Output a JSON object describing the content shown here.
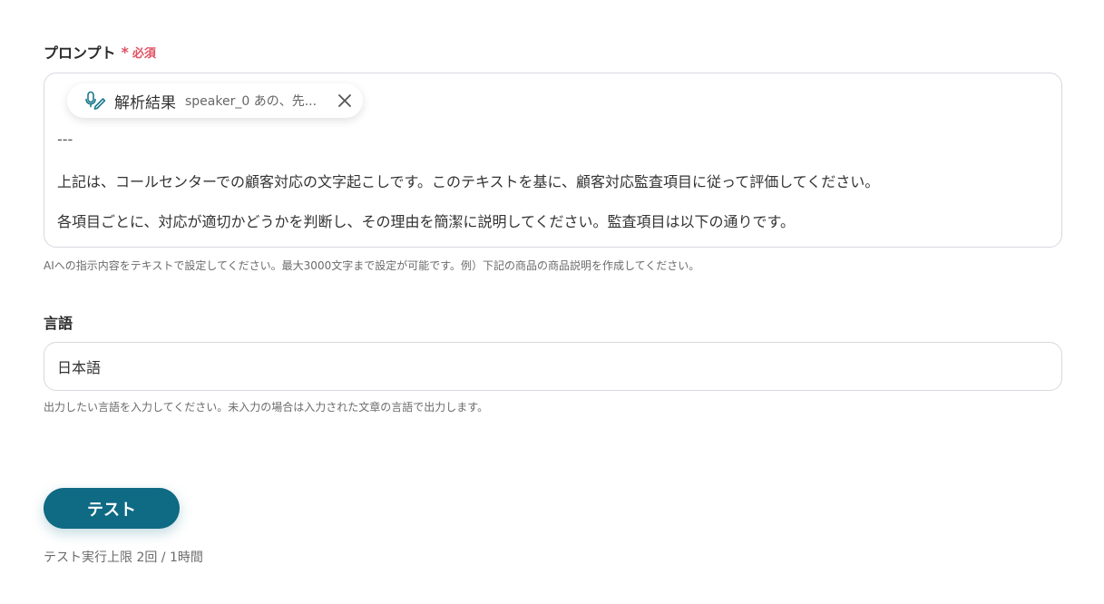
{
  "prompt_field": {
    "label": "プロンプト",
    "required_mark": "*",
    "required_text": "必須",
    "chip": {
      "icon": "audio-transcribe-icon",
      "label": "解析結果",
      "value": "speaker_0 あの、先...",
      "close_icon": "close-icon"
    },
    "lines": [
      "---",
      "上記は、コールセンターでの顧客対応の文字起こしです。このテキストを基に、顧客対応監査項目に従って評価してください。",
      "各項目ごとに、対応が適切かどうかを判断し、その理由を簡潔に説明してください。監査項目は以下の通りです。"
    ],
    "help": "AIへの指示内容をテキストで設定してください。最大3000文字まで設定が可能です。例）下記の商品の商品説明を作成してください。"
  },
  "language_field": {
    "label": "言語",
    "value": "日本語",
    "help": "出力したい言語を入力してください。未入力の場合は入力された文章の言語で出力します。"
  },
  "test": {
    "button_label": "テスト",
    "limit_text": "テスト実行上限 2回 / 1時間"
  },
  "colors": {
    "accent": "#0f6a84",
    "required": "#e05262",
    "chip_icon": "#1a7a8c"
  }
}
